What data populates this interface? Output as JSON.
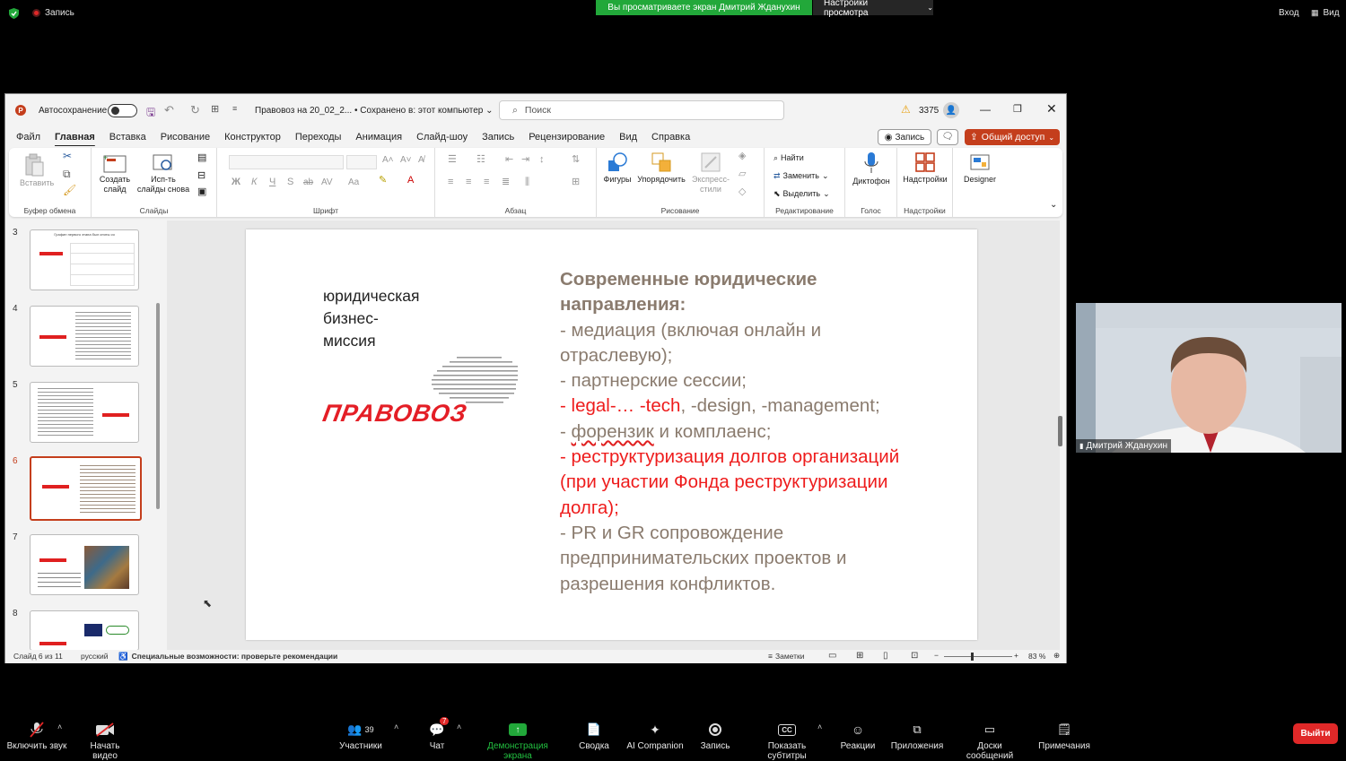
{
  "zoom": {
    "recording_label": "Запись",
    "share_banner": "Вы просматриваете экран Дмитрий Жданухин",
    "view_options": "Настройки просмотра",
    "login": "Вход",
    "view": "Вид",
    "participant_name": "Дмитрий Жданухин",
    "bottom": {
      "mute": "Включить звук",
      "video": "Начать видео",
      "participants": "Участники",
      "participants_count": "39",
      "chat": "Чат",
      "chat_badge": "7",
      "share": "Демонстрация экрана",
      "summary": "Сводка",
      "ai": "AI Companion",
      "record": "Запись",
      "captions": "Показать субтитры",
      "reactions": "Реакции",
      "apps": "Приложения",
      "whiteboards": "Доски сообщений",
      "notes": "Примечания",
      "leave": "Выйти"
    },
    "colors": {
      "share_green": "#22a83a",
      "leave_red": "#e02828"
    }
  },
  "ppt": {
    "autosave": "Автосохранение",
    "filename": "Правовоз на 20_02_2...",
    "saved": "• Сохранено в: этот компьютер",
    "search_placeholder": "Поиск",
    "warning_count": "3375",
    "menu": [
      "Файл",
      "Главная",
      "Вставка",
      "Рисование",
      "Конструктор",
      "Переходы",
      "Анимация",
      "Слайд-шоу",
      "Запись",
      "Рецензирование",
      "Вид",
      "Справка"
    ],
    "record_btn": "Запись",
    "share_btn": "Общий доступ",
    "ribbon": {
      "paste": "Вставить",
      "clipboard": "Буфер обмена",
      "new_slide": "Создать слайд",
      "reuse": "Исп-ть слайды снова",
      "slides": "Слайды",
      "font_group": "Шрифт",
      "paragraph": "Абзац",
      "shapes": "Фигуры",
      "arrange": "Упорядочить",
      "quick_styles": "Экспресс-стили",
      "drawing": "Рисование",
      "find": "Найти",
      "replace": "Заменить",
      "select": "Выделить",
      "editing": "Редактирование",
      "dictate": "Диктофон",
      "voice": "Голос",
      "addins": "Надстройки",
      "addins_group": "Надстройки",
      "designer": "Designer"
    },
    "thumbs": [
      {
        "num": "3",
        "title": "Графин первого этапа был сняты ся"
      },
      {
        "num": "4",
        "title": ""
      },
      {
        "num": "5",
        "title": ""
      },
      {
        "num": "6",
        "title": ""
      },
      {
        "num": "7",
        "title": ""
      },
      {
        "num": "8",
        "title": ""
      }
    ],
    "slide": {
      "tagline_1": "юридическая",
      "tagline_2": "бизнес-",
      "tagline_3": "миссия",
      "logo": "ПРАВОВОЗ",
      "heading_1": "Современные юридические",
      "heading_2": "направления:",
      "line_1": "- медиация (включая онлайн и",
      "line_2": "отраслевую);",
      "line_3": "- партнерские сессии;",
      "line_4_red": "- legal-… -tech",
      "line_4_rest": ", -design, -management;",
      "line_5_a": "- ",
      "line_5_b": "форензик",
      "line_5_c": " и комплаенс;",
      "line_6": "- реструктуризация долгов организаций",
      "line_7": "(при участии Фонда реструктуризации",
      "line_8": "долга);",
      "line_9": "- PR и GR сопровождение",
      "line_10": "предпринимательских проектов и",
      "line_11": "разрешения конфликтов."
    },
    "status": {
      "slide_of": "Слайд 6 из 11",
      "lang": "русский",
      "accessibility": "Специальные возможности: проверьте рекомендации",
      "notes": "Заметки",
      "zoom": "83 %"
    },
    "colors": {
      "accent": "#c43e1c",
      "text_brown": "#8a7b6e",
      "text_red": "#ee1c1c"
    }
  }
}
